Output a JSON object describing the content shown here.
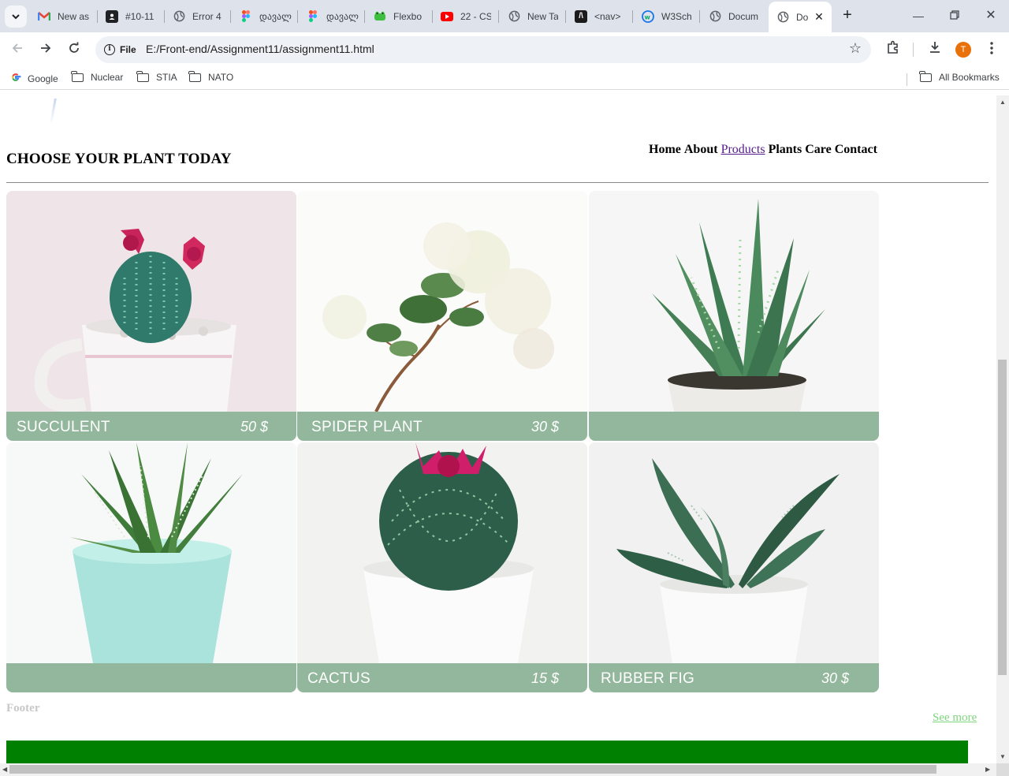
{
  "browser": {
    "tabs": [
      {
        "title": "New as",
        "icon": "gmail-icon"
      },
      {
        "title": "#10-11",
        "icon": "contact-card-icon"
      },
      {
        "title": "Error 4",
        "icon": "globe-icon"
      },
      {
        "title": "დავალ",
        "icon": "figma-icon"
      },
      {
        "title": "დავალ",
        "icon": "figma-icon"
      },
      {
        "title": "Flexbo",
        "icon": "frog-icon"
      },
      {
        "title": "22 - CS",
        "icon": "youtube-icon"
      },
      {
        "title": "New Ta",
        "icon": "globe-icon"
      },
      {
        "title": "<nav>",
        "icon": "mdn-icon"
      },
      {
        "title": "W3Sch",
        "icon": "w3schools-icon"
      },
      {
        "title": "Docum",
        "icon": "globe-icon"
      },
      {
        "title": "Do",
        "icon": "globe-icon",
        "active": true
      }
    ],
    "address": {
      "chip": "File",
      "url": "E:/Front-end/Assignment11/assignment11.html"
    },
    "avatar_letter": "T",
    "bookmarks": [
      {
        "label": "Google",
        "icon": "google-icon"
      },
      {
        "label": "Nuclear",
        "icon": "folder-icon"
      },
      {
        "label": "STIA",
        "icon": "folder-icon"
      },
      {
        "label": "NATO",
        "icon": "folder-icon"
      }
    ],
    "all_bookmarks": "All Bookmarks"
  },
  "page": {
    "title": "CHOOSE YOUR PLANT TODAY",
    "nav": [
      {
        "label": "Home",
        "visited": false
      },
      {
        "label": "About",
        "visited": false
      },
      {
        "label": "Products",
        "visited": true
      },
      {
        "label": "Plants Care",
        "visited": false
      },
      {
        "label": "Contact",
        "visited": false
      }
    ],
    "products": [
      {
        "name": "SUCCULENT",
        "price": "50 $",
        "photo": "pink-flowering-cactus-in-mug"
      },
      {
        "name": "SPIDER PLANT",
        "price": "30 $",
        "photo": "leafy-branch-with-white-flowers"
      },
      {
        "name": "",
        "price": "",
        "photo": "aloe-in-white-pot"
      },
      {
        "name": "",
        "price": "",
        "photo": "haworthia-in-mint-pot"
      },
      {
        "name": "CACTUS",
        "price": "15 $",
        "photo": "round-cactus-with-pink-flower"
      },
      {
        "name": "RUBBER FIG",
        "price": "30 $",
        "photo": "gasteria-in-white-pot"
      }
    ],
    "footer_label": "Footer",
    "see_more": "See more"
  },
  "colors": {
    "caption_bg": "#93b79c",
    "green_bar": "#008000",
    "visited_link": "#551a8b",
    "see_more": "#7ed67e"
  }
}
